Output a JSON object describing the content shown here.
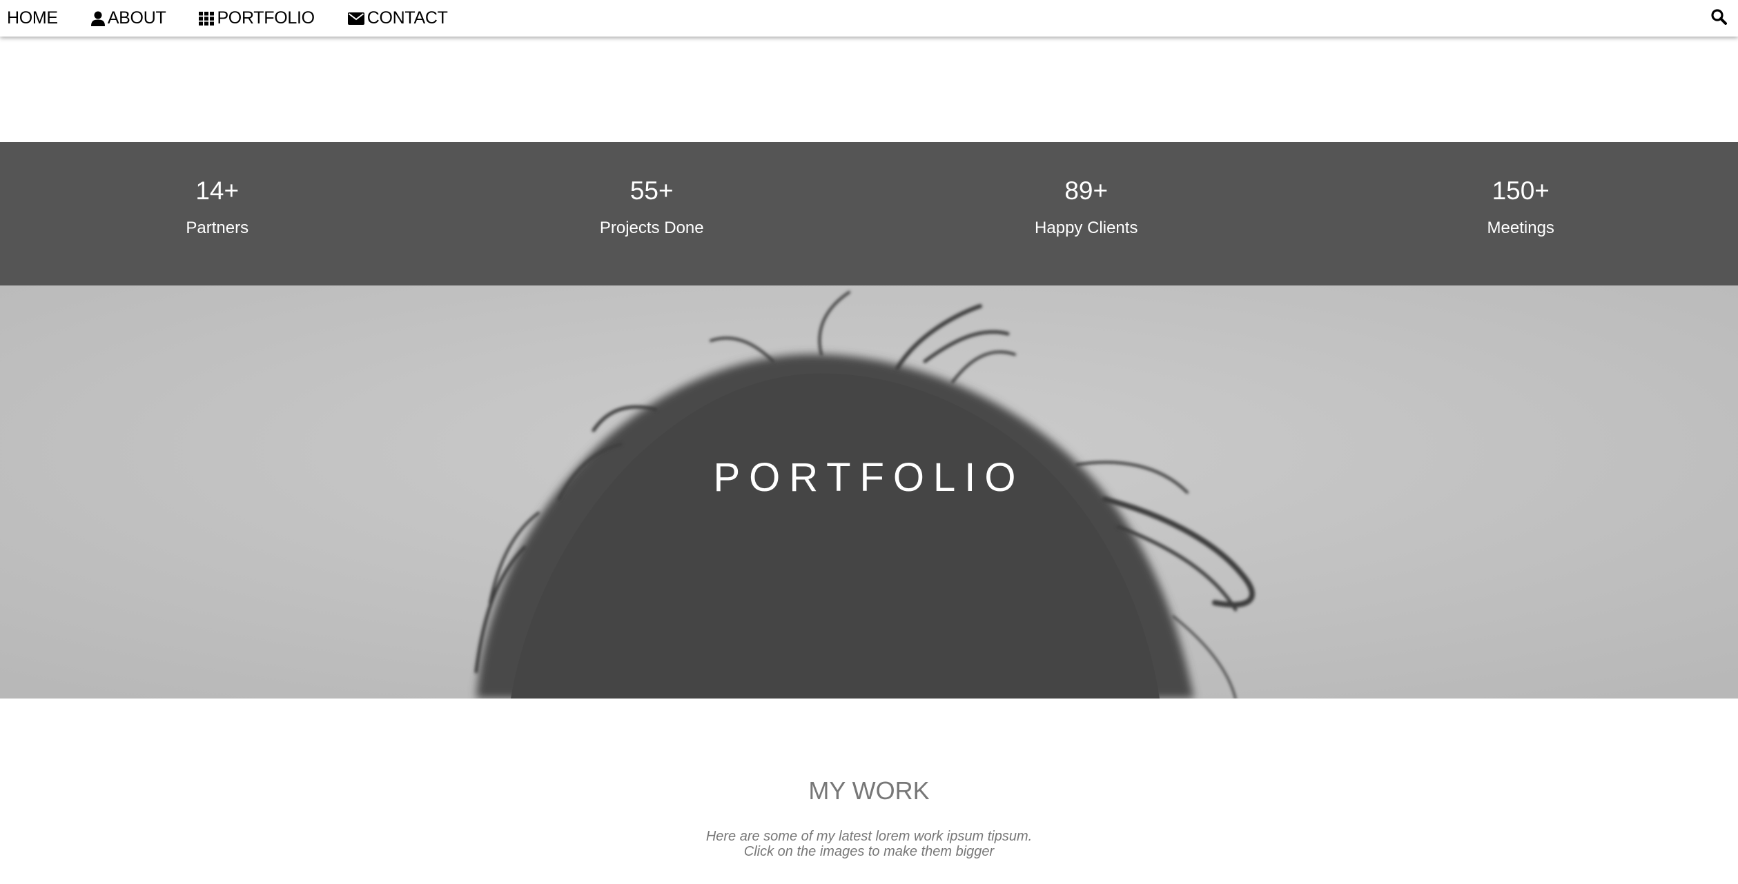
{
  "nav": {
    "items": [
      {
        "label": "HOME",
        "icon": "none"
      },
      {
        "label": "ABOUT",
        "icon": "user-icon"
      },
      {
        "label": "PORTFOLIO",
        "icon": "grid-icon"
      },
      {
        "label": "CONTACT",
        "icon": "envelope-icon"
      }
    ],
    "search_icon": "search-icon"
  },
  "stats": [
    {
      "value": "14+",
      "label": "Partners"
    },
    {
      "value": "55+",
      "label": "Projects Done"
    },
    {
      "value": "89+",
      "label": "Happy Clients"
    },
    {
      "value": "150+",
      "label": "Meetings"
    }
  ],
  "hero": {
    "title": "PORTFOLIO"
  },
  "work": {
    "title": "MY WORK",
    "line1": "Here are some of my latest lorem work ipsum tipsum.",
    "line2": "Click on the images to make them bigger"
  },
  "colors": {
    "stats_bg": "#555555",
    "hero_bg": "#c4c4c4",
    "muted_text": "#777777"
  }
}
